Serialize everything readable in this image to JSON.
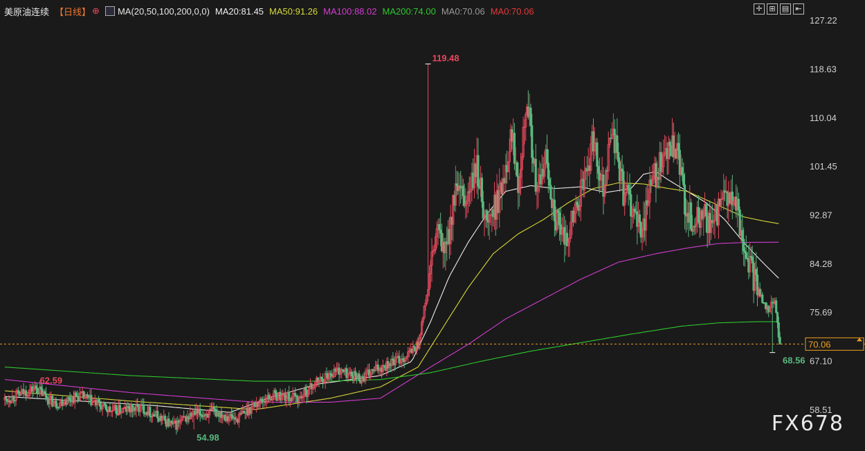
{
  "header": {
    "symbol": "美原油连续",
    "period": "【日线】",
    "ma_params": "MA(20,50,100,200,0,0)",
    "ma20": "MA20:81.45",
    "ma50": "MA50:91.26",
    "ma100": "MA100:88.02",
    "ma200": "MA200:74.00",
    "ma0a": "MA0:70.06",
    "ma0b": "MA0:70.06"
  },
  "toolbar_icons": [
    "crosshair-icon",
    "grid-icon",
    "chart-icon",
    "expand-icon"
  ],
  "colors": {
    "up": "#e8495d",
    "down": "#5ab87e",
    "ma20": "#f0f0f0",
    "ma50": "#d8d83a",
    "ma100": "#d23cd2",
    "ma200": "#2ec82e",
    "last_price": "#f0a020"
  },
  "watermark": "FX678",
  "chart_data": {
    "type": "candlestick",
    "ylim": [
      54.0,
      127.22
    ],
    "y_ticks": [
      "127.22",
      "118.63",
      "110.04",
      "101.45",
      "92.87",
      "84.28",
      "75.69",
      "67.10",
      "58.51"
    ],
    "last_price": "70.06",
    "annotations": {
      "high": "119.48",
      "low": "54.98",
      "local_high": "62.59",
      "recent_low": "68.56"
    },
    "segments": [
      [
        0,
        60.2
      ],
      [
        25,
        62.3
      ],
      [
        40,
        59.5
      ],
      [
        60,
        61.0
      ],
      [
        85,
        58.2
      ],
      [
        110,
        58.8
      ],
      [
        135,
        55.6
      ],
      [
        150,
        57.6
      ],
      [
        170,
        58.0
      ],
      [
        185,
        56.8
      ],
      [
        200,
        59.5
      ],
      [
        215,
        61.0
      ],
      [
        235,
        60.5
      ],
      [
        250,
        63.5
      ],
      [
        265,
        65.5
      ],
      [
        285,
        64.0
      ],
      [
        300,
        66.0
      ],
      [
        320,
        67.8
      ],
      [
        330,
        70.0
      ],
      [
        335,
        76.0
      ],
      [
        345,
        90.0
      ],
      [
        352,
        86.0
      ],
      [
        360,
        97.0
      ],
      [
        368,
        95.0
      ],
      [
        377,
        101.0
      ],
      [
        385,
        91.0
      ],
      [
        395,
        96.0
      ],
      [
        405,
        107.5
      ],
      [
        410,
        99.0
      ],
      [
        417,
        114.0
      ],
      [
        425,
        96.0
      ],
      [
        432,
        103.0
      ],
      [
        440,
        92.0
      ],
      [
        447,
        88.0
      ],
      [
        455,
        93.0
      ],
      [
        463,
        99.0
      ],
      [
        470,
        106.0
      ],
      [
        478,
        98.0
      ],
      [
        485,
        108.5
      ],
      [
        494,
        97.0
      ],
      [
        500,
        95.0
      ],
      [
        508,
        89.0
      ],
      [
        516,
        98.5
      ],
      [
        526,
        102.5
      ],
      [
        532,
        104.5
      ],
      [
        538,
        103.0
      ],
      [
        543,
        95.0
      ],
      [
        550,
        91.0
      ],
      [
        558,
        93.0
      ],
      [
        565,
        90.0
      ],
      [
        570,
        94.0
      ],
      [
        578,
        96.0
      ],
      [
        586,
        93.0
      ],
      [
        591,
        86.5
      ],
      [
        597,
        82.5
      ],
      [
        605,
        78.0
      ],
      [
        610,
        76.5
      ],
      [
        615,
        77.5
      ],
      [
        619,
        70.06
      ]
    ],
    "ma_series": [
      {
        "name": "MA20",
        "color": "#f0f0f0",
        "end": 81.45,
        "points": [
          [
            0,
            60.8
          ],
          [
            60,
            60.0
          ],
          [
            120,
            59.2
          ],
          [
            180,
            58.0
          ],
          [
            210,
            60.5
          ],
          [
            250,
            63.0
          ],
          [
            300,
            64.5
          ],
          [
            325,
            67.0
          ],
          [
            340,
            74.0
          ],
          [
            355,
            82.0
          ],
          [
            370,
            88.0
          ],
          [
            385,
            93.0
          ],
          [
            400,
            97.0
          ],
          [
            420,
            98.0
          ],
          [
            440,
            97.5
          ],
          [
            460,
            97.8
          ],
          [
            480,
            96.8
          ],
          [
            500,
            97.5
          ],
          [
            510,
            100.0
          ],
          [
            520,
            100.5
          ],
          [
            530,
            99.0
          ],
          [
            545,
            97.0
          ],
          [
            560,
            95.0
          ],
          [
            575,
            92.0
          ],
          [
            590,
            88.0
          ],
          [
            605,
            84.5
          ],
          [
            619,
            81.45
          ]
        ]
      },
      {
        "name": "MA50",
        "color": "#d8d83a",
        "end": 91.26,
        "points": [
          [
            0,
            61.8
          ],
          [
            100,
            60.0
          ],
          [
            200,
            58.5
          ],
          [
            260,
            60.5
          ],
          [
            300,
            62.5
          ],
          [
            330,
            66.0
          ],
          [
            350,
            73.0
          ],
          [
            370,
            80.0
          ],
          [
            390,
            86.0
          ],
          [
            410,
            89.5
          ],
          [
            430,
            92.0
          ],
          [
            450,
            95.0
          ],
          [
            470,
            97.5
          ],
          [
            490,
            98.5
          ],
          [
            510,
            98.3
          ],
          [
            530,
            97.5
          ],
          [
            545,
            97.0
          ],
          [
            560,
            95.5
          ],
          [
            575,
            94.0
          ],
          [
            590,
            92.5
          ],
          [
            605,
            91.8
          ],
          [
            619,
            91.26
          ]
        ]
      },
      {
        "name": "MA100",
        "color": "#d23cd2",
        "end": 88.02,
        "points": [
          [
            0,
            63.8
          ],
          [
            100,
            61.5
          ],
          [
            200,
            59.8
          ],
          [
            260,
            59.8
          ],
          [
            300,
            60.5
          ],
          [
            340,
            66.0
          ],
          [
            370,
            70.0
          ],
          [
            400,
            74.5
          ],
          [
            430,
            78.0
          ],
          [
            460,
            81.5
          ],
          [
            490,
            84.5
          ],
          [
            520,
            86.0
          ],
          [
            545,
            87.0
          ],
          [
            570,
            87.8
          ],
          [
            595,
            88.0
          ],
          [
            619,
            88.02
          ]
        ]
      },
      {
        "name": "MA200",
        "color": "#2ec82e",
        "end": 74.0,
        "points": [
          [
            0,
            66.0
          ],
          [
            100,
            64.5
          ],
          [
            200,
            63.5
          ],
          [
            260,
            63.5
          ],
          [
            300,
            63.8
          ],
          [
            340,
            65.0
          ],
          [
            380,
            67.0
          ],
          [
            420,
            68.8
          ],
          [
            460,
            70.3
          ],
          [
            500,
            71.8
          ],
          [
            540,
            73.2
          ],
          [
            570,
            73.8
          ],
          [
            600,
            74.0
          ],
          [
            619,
            74.0
          ]
        ]
      }
    ]
  }
}
